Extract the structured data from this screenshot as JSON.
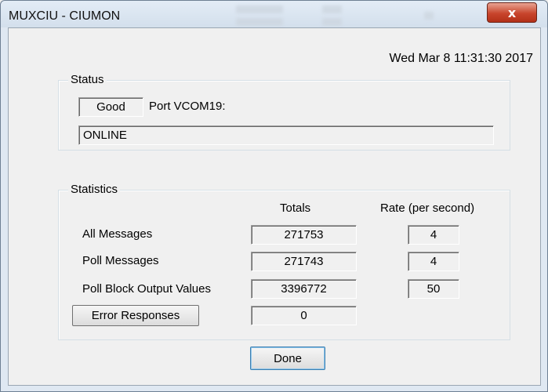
{
  "window": {
    "title": "MUXCIU - CIUMON",
    "close_glyph": "x"
  },
  "datetime": "Wed Mar  8 11:31:30 2017",
  "status": {
    "legend": "Status",
    "state": "Good",
    "port": "Port VCOM19:",
    "message": "ONLINE"
  },
  "statistics": {
    "legend": "Statistics",
    "totals_header": "Totals",
    "rate_header": "Rate (per second)",
    "rows": [
      {
        "label": "All Messages",
        "total": "271753",
        "rate": "4"
      },
      {
        "label": "Poll Messages",
        "total": "271743",
        "rate": "4"
      },
      {
        "label": "Poll Block Output Values",
        "total": "3396772",
        "rate": "50"
      },
      {
        "label": "Error Responses",
        "total": "0",
        "rate": ""
      }
    ]
  },
  "done_label": "Done",
  "colors": {
    "close_button": "#c8452c",
    "frame": "#dfe8f2",
    "dialog": "#f0f0f0"
  }
}
